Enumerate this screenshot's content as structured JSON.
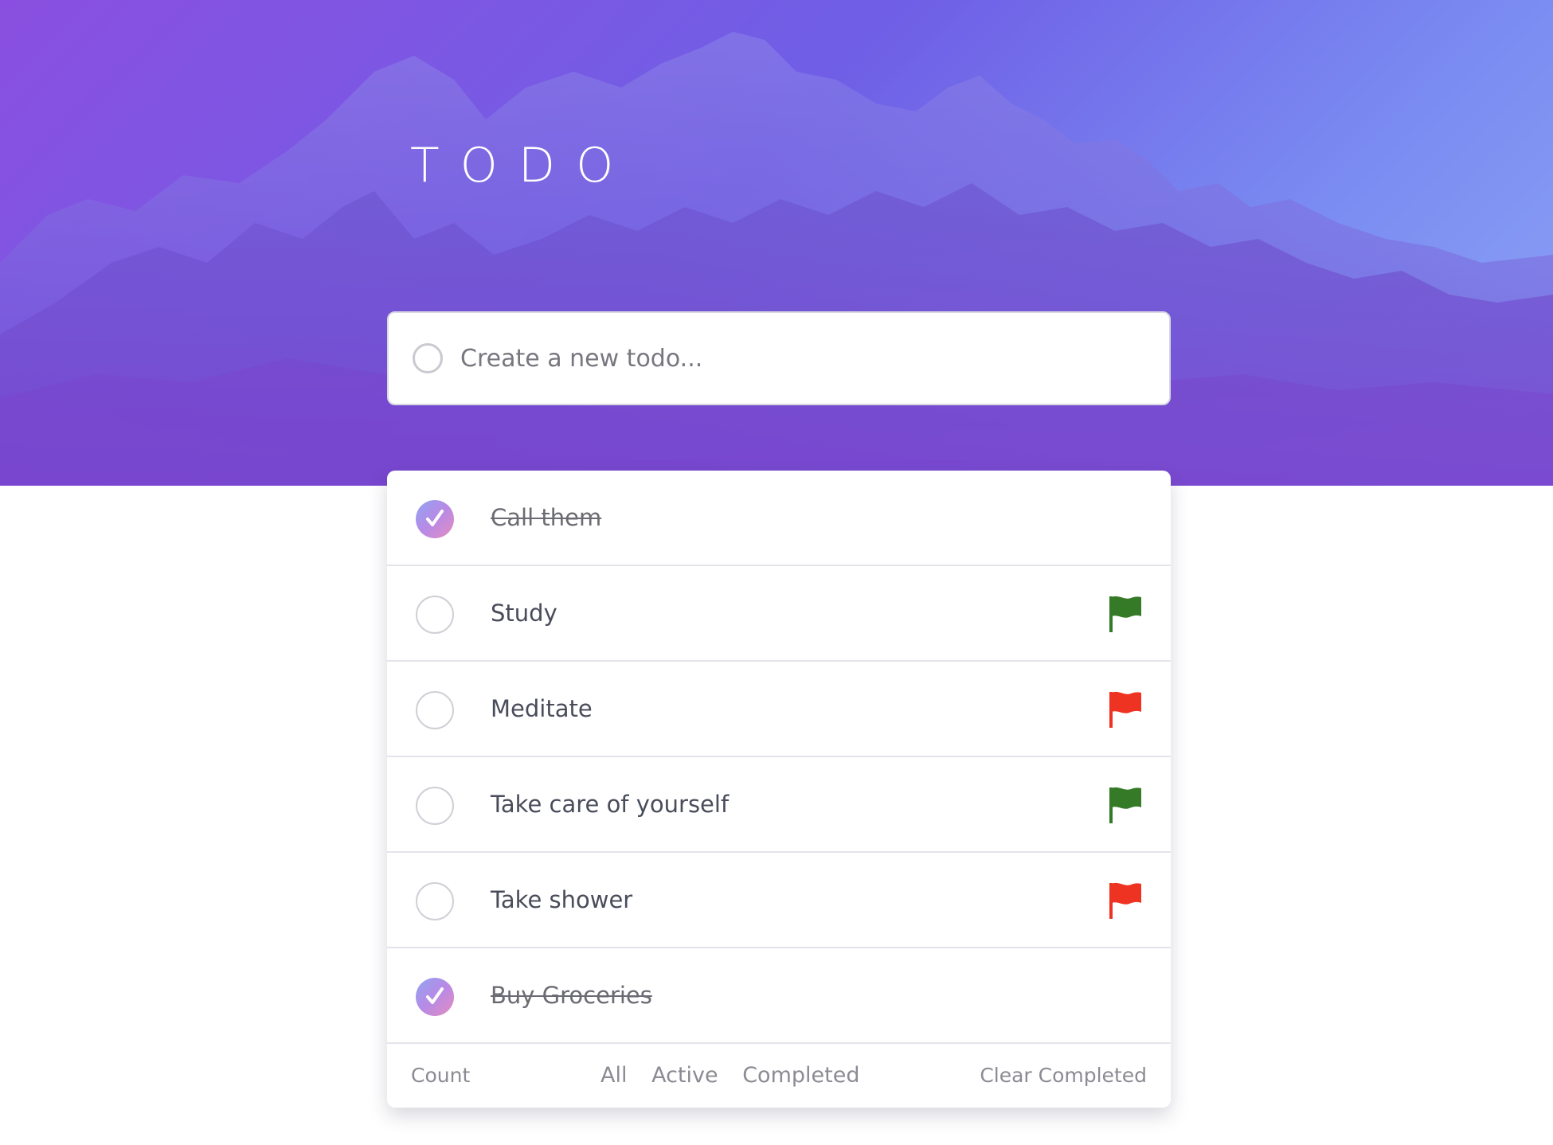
{
  "header": {
    "title": "TODO"
  },
  "new_todo": {
    "placeholder": "Create a new todo..."
  },
  "todos": [
    {
      "text": "Call them",
      "completed": true,
      "flag": null
    },
    {
      "text": "Study",
      "completed": false,
      "flag": "green"
    },
    {
      "text": "Meditate",
      "completed": false,
      "flag": "red"
    },
    {
      "text": "Take care of yourself",
      "completed": false,
      "flag": "green"
    },
    {
      "text": "Take shower",
      "completed": false,
      "flag": "red"
    },
    {
      "text": "Buy Groceries",
      "completed": true,
      "flag": null
    }
  ],
  "footer": {
    "count_label": "Count",
    "filters": [
      "All",
      "Active",
      "Completed"
    ],
    "clear_label": "Clear Completed"
  },
  "icons": {
    "completed_check": "checkmark-icon",
    "priority_flag": "flag-icon",
    "new_todo_circle": "circle-icon"
  },
  "colors": {
    "flag_green": "#357a26",
    "flag_red": "#ee3322",
    "hero_gradient_start": "#8a4fe0",
    "hero_gradient_end": "#8ea3f4",
    "check_gradient_start": "#8fa4f2",
    "check_gradient_end": "#e58cc0"
  }
}
